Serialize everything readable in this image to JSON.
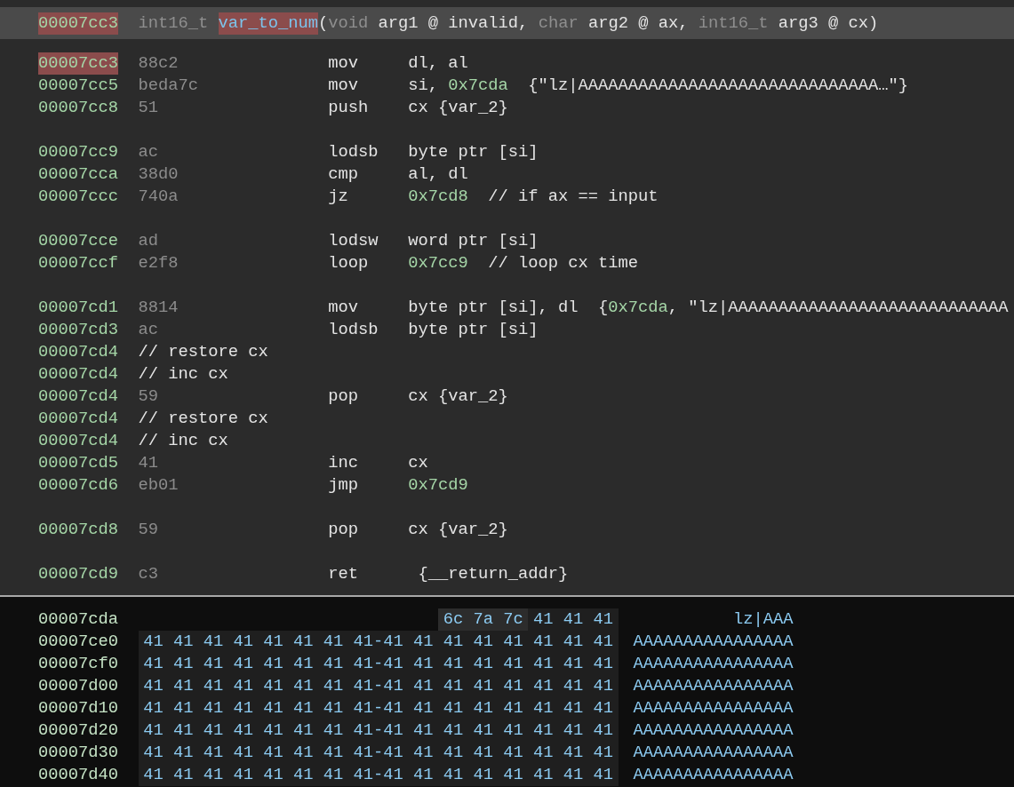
{
  "disassembly": {
    "header": [
      {
        "kind": "address",
        "text": "00007cc3",
        "selected": true
      },
      {
        "kind": "type",
        "text": "int16_t "
      },
      {
        "kind": "name",
        "text": "var_to_num",
        "selected": true
      },
      {
        "kind": "text",
        "text": "("
      },
      {
        "kind": "type",
        "text": "void "
      },
      {
        "kind": "text",
        "text": "arg1 @ invalid, "
      },
      {
        "kind": "type",
        "text": "char "
      },
      {
        "kind": "text",
        "text": "arg2 @ ax, "
      },
      {
        "kind": "type",
        "text": "int16_t "
      },
      {
        "kind": "text",
        "text": "arg3 @ cx)"
      }
    ],
    "lines": [
      {
        "kind": "instruction",
        "address": "00007cc3",
        "selected": true,
        "bytes": "88c2",
        "mnemonic": "mov",
        "operands": [
          {
            "kind": "text",
            "text": "dl, al"
          }
        ]
      },
      {
        "kind": "instruction",
        "address": "00007cc5",
        "selected": false,
        "bytes": "beda7c",
        "mnemonic": "mov",
        "operands": [
          {
            "kind": "text",
            "text": "si, "
          },
          {
            "kind": "address",
            "text": "0x7cda"
          },
          {
            "kind": "text",
            "text": "  {\"lz|AAAAAAAAAAAAAAAAAAAAAAAAAAAAAA…\"}"
          }
        ]
      },
      {
        "kind": "instruction",
        "address": "00007cc8",
        "selected": false,
        "bytes": "51",
        "mnemonic": "push",
        "operands": [
          {
            "kind": "text",
            "text": "cx {var_2}"
          }
        ]
      },
      {
        "kind": "blank"
      },
      {
        "kind": "instruction",
        "address": "00007cc9",
        "selected": false,
        "bytes": "ac",
        "mnemonic": "lodsb",
        "operands": [
          {
            "kind": "text",
            "text": "byte ptr [si]"
          }
        ]
      },
      {
        "kind": "instruction",
        "address": "00007cca",
        "selected": false,
        "bytes": "38d0",
        "mnemonic": "cmp",
        "operands": [
          {
            "kind": "text",
            "text": "al, dl"
          }
        ]
      },
      {
        "kind": "instruction",
        "address": "00007ccc",
        "selected": false,
        "bytes": "740a",
        "mnemonic": "jz",
        "operands": [
          {
            "kind": "address",
            "text": "0x7cd8"
          },
          {
            "kind": "text",
            "text": "  // if ax == input"
          }
        ]
      },
      {
        "kind": "blank"
      },
      {
        "kind": "instruction",
        "address": "00007cce",
        "selected": false,
        "bytes": "ad",
        "mnemonic": "lodsw",
        "operands": [
          {
            "kind": "text",
            "text": "word ptr [si]"
          }
        ]
      },
      {
        "kind": "instruction",
        "address": "00007ccf",
        "selected": false,
        "bytes": "e2f8",
        "mnemonic": "loop",
        "operands": [
          {
            "kind": "address",
            "text": "0x7cc9"
          },
          {
            "kind": "text",
            "text": "  // loop cx time"
          }
        ]
      },
      {
        "kind": "blank"
      },
      {
        "kind": "instruction",
        "address": "00007cd1",
        "selected": false,
        "bytes": "8814",
        "mnemonic": "mov",
        "operands": [
          {
            "kind": "text",
            "text": "byte ptr [si], dl  {"
          },
          {
            "kind": "address",
            "text": "0x7cda"
          },
          {
            "kind": "text",
            "text": ", \"lz|AAAAAAAAAAAAAAAAAAAAAAAAAAAA"
          }
        ]
      },
      {
        "kind": "instruction",
        "address": "00007cd3",
        "selected": false,
        "bytes": "ac",
        "mnemonic": "lodsb",
        "operands": [
          {
            "kind": "text",
            "text": "byte ptr [si]"
          }
        ]
      },
      {
        "kind": "comment",
        "address": "00007cd4",
        "text": "// restore cx"
      },
      {
        "kind": "comment",
        "address": "00007cd4",
        "text": "// inc cx"
      },
      {
        "kind": "instruction",
        "address": "00007cd4",
        "selected": false,
        "bytes": "59",
        "mnemonic": "pop",
        "operands": [
          {
            "kind": "text",
            "text": "cx {var_2}"
          }
        ]
      },
      {
        "kind": "comment",
        "address": "00007cd4",
        "text": "// restore cx"
      },
      {
        "kind": "comment",
        "address": "00007cd4",
        "text": "// inc cx"
      },
      {
        "kind": "instruction",
        "address": "00007cd5",
        "selected": false,
        "bytes": "41",
        "mnemonic": "inc",
        "operands": [
          {
            "kind": "text",
            "text": "cx"
          }
        ]
      },
      {
        "kind": "instruction",
        "address": "00007cd6",
        "selected": false,
        "bytes": "eb01",
        "mnemonic": "jmp",
        "operands": [
          {
            "kind": "address",
            "text": "0x7cd9"
          }
        ]
      },
      {
        "kind": "blank"
      },
      {
        "kind": "instruction",
        "address": "00007cd8",
        "selected": false,
        "bytes": "59",
        "mnemonic": "pop",
        "operands": [
          {
            "kind": "text",
            "text": "cx {var_2}"
          }
        ]
      },
      {
        "kind": "blank"
      },
      {
        "kind": "instruction",
        "address": "00007cd9",
        "selected": false,
        "bytes": "c3",
        "mnemonic": "ret",
        "operands": [
          {
            "kind": "text",
            "text": " {__return_addr}"
          }
        ]
      }
    ]
  },
  "hex_view": {
    "rows": [
      {
        "address": "00007cda",
        "ascii": "lz|AAA",
        "bytes": [
          {
            "value": "6c",
            "selected": true
          },
          {
            "value": "7a",
            "selected": true
          },
          {
            "value": "7c",
            "selected": true
          },
          {
            "value": "41",
            "selected": false
          },
          {
            "value": "41",
            "selected": false
          },
          {
            "value": "41",
            "selected": false
          }
        ]
      },
      {
        "address": "00007ce0",
        "separator": "-",
        "ascii": "AAAAAAAAAAAAAAAA",
        "bytes": [
          {
            "value": "41",
            "selected": false
          },
          {
            "value": "41",
            "selected": false
          },
          {
            "value": "41",
            "selected": false
          },
          {
            "value": "41",
            "selected": false
          },
          {
            "value": "41",
            "selected": false
          },
          {
            "value": "41",
            "selected": false
          },
          {
            "value": "41",
            "selected": false
          },
          {
            "value": "41",
            "selected": false
          },
          {
            "value": "41",
            "selected": false
          },
          {
            "value": "41",
            "selected": false
          },
          {
            "value": "41",
            "selected": false
          },
          {
            "value": "41",
            "selected": false
          },
          {
            "value": "41",
            "selected": false
          },
          {
            "value": "41",
            "selected": false
          },
          {
            "value": "41",
            "selected": false
          },
          {
            "value": "41",
            "selected": false
          }
        ]
      },
      {
        "address": "00007cf0",
        "separator": "-",
        "ascii": "AAAAAAAAAAAAAAAA",
        "bytes": [
          {
            "value": "41",
            "selected": false
          },
          {
            "value": "41",
            "selected": false
          },
          {
            "value": "41",
            "selected": false
          },
          {
            "value": "41",
            "selected": false
          },
          {
            "value": "41",
            "selected": false
          },
          {
            "value": "41",
            "selected": false
          },
          {
            "value": "41",
            "selected": false
          },
          {
            "value": "41",
            "selected": false
          },
          {
            "value": "41",
            "selected": false
          },
          {
            "value": "41",
            "selected": false
          },
          {
            "value": "41",
            "selected": false
          },
          {
            "value": "41",
            "selected": false
          },
          {
            "value": "41",
            "selected": false
          },
          {
            "value": "41",
            "selected": false
          },
          {
            "value": "41",
            "selected": false
          },
          {
            "value": "41",
            "selected": false
          }
        ]
      },
      {
        "address": "00007d00",
        "separator": "-",
        "ascii": "AAAAAAAAAAAAAAAA",
        "bytes": [
          {
            "value": "41",
            "selected": false
          },
          {
            "value": "41",
            "selected": false
          },
          {
            "value": "41",
            "selected": false
          },
          {
            "value": "41",
            "selected": false
          },
          {
            "value": "41",
            "selected": false
          },
          {
            "value": "41",
            "selected": false
          },
          {
            "value": "41",
            "selected": false
          },
          {
            "value": "41",
            "selected": false
          },
          {
            "value": "41",
            "selected": false
          },
          {
            "value": "41",
            "selected": false
          },
          {
            "value": "41",
            "selected": false
          },
          {
            "value": "41",
            "selected": false
          },
          {
            "value": "41",
            "selected": false
          },
          {
            "value": "41",
            "selected": false
          },
          {
            "value": "41",
            "selected": false
          },
          {
            "value": "41",
            "selected": false
          }
        ]
      },
      {
        "address": "00007d10",
        "separator": "-",
        "ascii": "AAAAAAAAAAAAAAAA",
        "bytes": [
          {
            "value": "41",
            "selected": false
          },
          {
            "value": "41",
            "selected": false
          },
          {
            "value": "41",
            "selected": false
          },
          {
            "value": "41",
            "selected": false
          },
          {
            "value": "41",
            "selected": false
          },
          {
            "value": "41",
            "selected": false
          },
          {
            "value": "41",
            "selected": false
          },
          {
            "value": "41",
            "selected": false
          },
          {
            "value": "41",
            "selected": false
          },
          {
            "value": "41",
            "selected": false
          },
          {
            "value": "41",
            "selected": false
          },
          {
            "value": "41",
            "selected": false
          },
          {
            "value": "41",
            "selected": false
          },
          {
            "value": "41",
            "selected": false
          },
          {
            "value": "41",
            "selected": false
          },
          {
            "value": "41",
            "selected": false
          }
        ]
      },
      {
        "address": "00007d20",
        "separator": "-",
        "ascii": "AAAAAAAAAAAAAAAA",
        "bytes": [
          {
            "value": "41",
            "selected": false
          },
          {
            "value": "41",
            "selected": false
          },
          {
            "value": "41",
            "selected": false
          },
          {
            "value": "41",
            "selected": false
          },
          {
            "value": "41",
            "selected": false
          },
          {
            "value": "41",
            "selected": false
          },
          {
            "value": "41",
            "selected": false
          },
          {
            "value": "41",
            "selected": false
          },
          {
            "value": "41",
            "selected": false
          },
          {
            "value": "41",
            "selected": false
          },
          {
            "value": "41",
            "selected": false
          },
          {
            "value": "41",
            "selected": false
          },
          {
            "value": "41",
            "selected": false
          },
          {
            "value": "41",
            "selected": false
          },
          {
            "value": "41",
            "selected": false
          },
          {
            "value": "41",
            "selected": false
          }
        ]
      },
      {
        "address": "00007d30",
        "separator": "-",
        "ascii": "AAAAAAAAAAAAAAAA",
        "bytes": [
          {
            "value": "41",
            "selected": false
          },
          {
            "value": "41",
            "selected": false
          },
          {
            "value": "41",
            "selected": false
          },
          {
            "value": "41",
            "selected": false
          },
          {
            "value": "41",
            "selected": false
          },
          {
            "value": "41",
            "selected": false
          },
          {
            "value": "41",
            "selected": false
          },
          {
            "value": "41",
            "selected": false
          },
          {
            "value": "41",
            "selected": false
          },
          {
            "value": "41",
            "selected": false
          },
          {
            "value": "41",
            "selected": false
          },
          {
            "value": "41",
            "selected": false
          },
          {
            "value": "41",
            "selected": false
          },
          {
            "value": "41",
            "selected": false
          },
          {
            "value": "41",
            "selected": false
          },
          {
            "value": "41",
            "selected": false
          }
        ]
      },
      {
        "address": "00007d40",
        "separator": "-",
        "ascii": "AAAAAAAAAAAAAAAA",
        "bytes": [
          {
            "value": "41",
            "selected": false
          },
          {
            "value": "41",
            "selected": false
          },
          {
            "value": "41",
            "selected": false
          },
          {
            "value": "41",
            "selected": false
          },
          {
            "value": "41",
            "selected": false
          },
          {
            "value": "41",
            "selected": false
          },
          {
            "value": "41",
            "selected": false
          },
          {
            "value": "41",
            "selected": false
          },
          {
            "value": "41",
            "selected": false
          },
          {
            "value": "41",
            "selected": false
          },
          {
            "value": "41",
            "selected": false
          },
          {
            "value": "41",
            "selected": false
          },
          {
            "value": "41",
            "selected": false
          },
          {
            "value": "41",
            "selected": false
          },
          {
            "value": "41",
            "selected": false
          },
          {
            "value": "41",
            "selected": false
          }
        ]
      }
    ]
  }
}
